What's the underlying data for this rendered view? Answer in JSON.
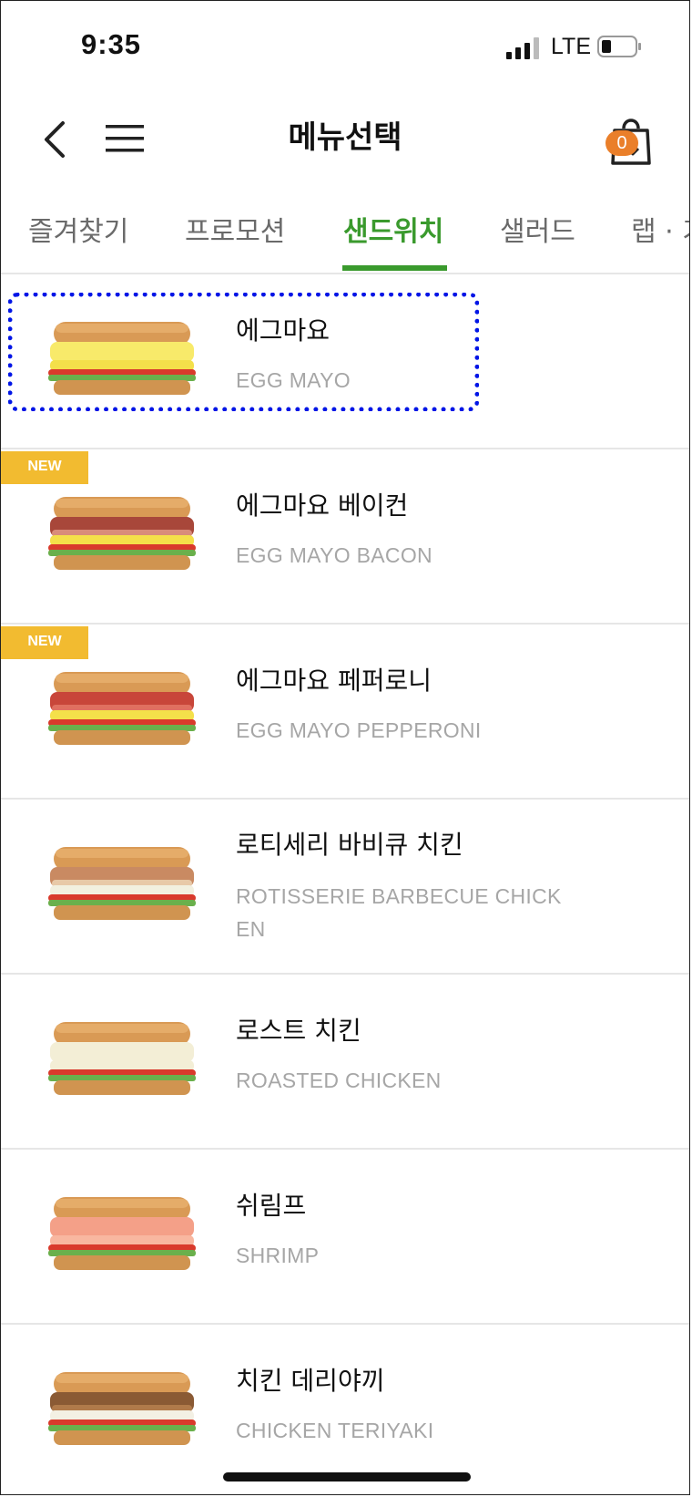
{
  "status_bar": {
    "time": "9:35",
    "network": "LTE"
  },
  "header": {
    "title": "메뉴선택",
    "cart_count": "0"
  },
  "tabs": [
    {
      "label": "즐겨찾기",
      "active": false
    },
    {
      "label": "프로모션",
      "active": false
    },
    {
      "label": "샌드위치",
      "active": true
    },
    {
      "label": "샐러드",
      "active": false
    },
    {
      "label": "랩 · 기",
      "active": false
    }
  ],
  "items": [
    {
      "name": "에그마요",
      "sub": "EGG MAYO",
      "badge": "",
      "type": "egg"
    },
    {
      "name": "에그마요 베이컨",
      "sub": "EGG MAYO BACON",
      "badge": "NEW",
      "type": "bacon"
    },
    {
      "name": "에그마요 페퍼로니",
      "sub": "EGG MAYO PEPPERONI",
      "badge": "NEW",
      "type": "pepperoni"
    },
    {
      "name": "로티세리 바비큐 치킨",
      "sub": "ROTISSERIE BARBECUE CHICK EN",
      "badge": "",
      "type": "bbq"
    },
    {
      "name": "로스트 치킨",
      "sub": "ROASTED CHICKEN",
      "badge": "",
      "type": "roast"
    },
    {
      "name": "쉬림프",
      "sub": "SHRIMP",
      "badge": "",
      "type": "shrimp"
    },
    {
      "name": "치킨 데리야끼",
      "sub": "CHICKEN TERIYAKI",
      "badge": "",
      "type": "teriyaki"
    }
  ],
  "colors": {
    "accent_green": "#3a9a2d",
    "badge_yellow": "#f2bb30",
    "cart_orange": "#ea7f2a",
    "highlight_blue": "#0015e6"
  },
  "icons": [
    "back-icon",
    "hamburger-menu-icon",
    "shopping-bag-icon"
  ]
}
